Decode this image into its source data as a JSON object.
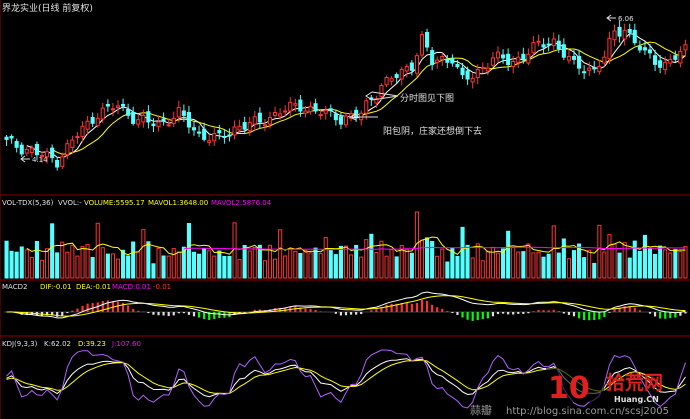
{
  "header": {
    "title": "界龙实业(日线 前复权)"
  },
  "annotations": {
    "high_label": "6.06",
    "low_label": "4.14",
    "note1": "分时图见下图",
    "note2": "阳包阴，庄家还想倒下去"
  },
  "vol_panel": {
    "label": "VOL-TDX(5,36)",
    "vvol": "VVOL:-",
    "volume": "VOLUME:5595.17",
    "mavol1": "MAVOL1:3648.00",
    "mavol2": "MAVOL2:5876.04"
  },
  "macd_panel": {
    "label": "MACD2",
    "dif": "DIF:-0.01",
    "dea": "DEA:-0.01",
    "macd": "MACD:0.01",
    "extra": "-0.01"
  },
  "kdj_panel": {
    "label": "KDJ(9,3,3)",
    "k": "K:62.02",
    "d": "D:39.23",
    "j": "J:107.60"
  },
  "watermark": {
    "logo_num": "10",
    "logo_cn": "拾荒网",
    "logo_en": "Huang.CN",
    "blog": "http://blog.sina.com.cn/scsj2005",
    "author": "蒜瓣"
  },
  "colors": {
    "up": "#ff3232",
    "down": "#54ffff",
    "panel_border": "#8b0000",
    "text_white": "#e0e0e0",
    "yellow": "#ffff00",
    "magenta": "#ff00ff",
    "green": "#00ff00",
    "purple": "#b060ff"
  },
  "chart_data": {
    "type": "candlestick",
    "price_range": [
      4.0,
      6.2
    ],
    "candles": []
  }
}
